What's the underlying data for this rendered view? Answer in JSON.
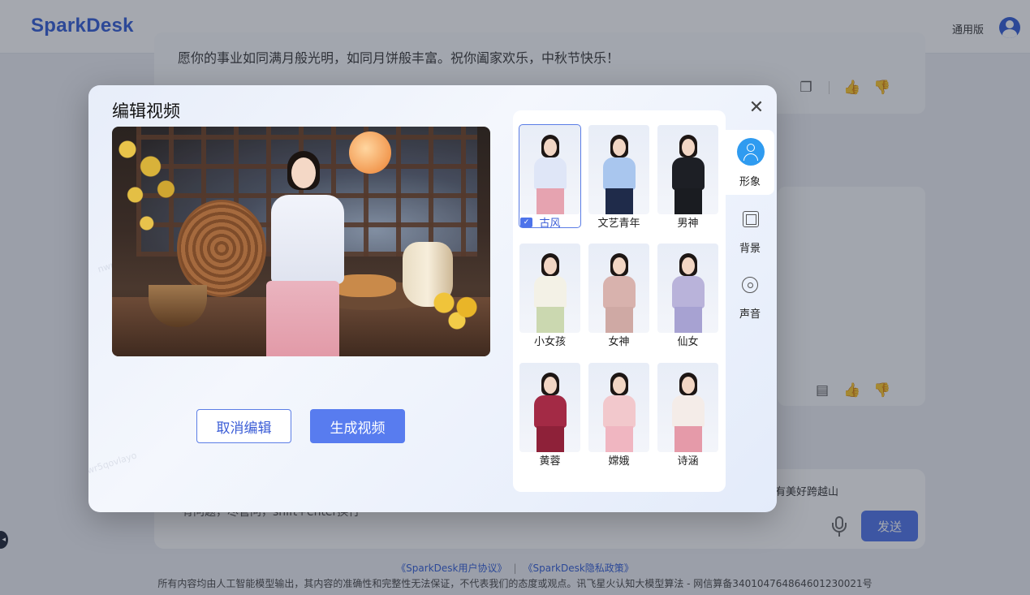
{
  "app": {
    "logo": "SparkDesk",
    "edition_label": "通用版"
  },
  "chat": {
    "message_text": "愿你的事业如同满月般光明，如同月饼般丰富。祝你阖家欢乐，中秋节快乐！",
    "composer_hint": "有问题，尽管问，shift+enter换行",
    "suggestion_text": "有美好跨越山",
    "send_label": "发送"
  },
  "footer": {
    "link_user_agreement": "《SparkDesk用户协议》",
    "link_privacy": "《SparkDesk隐私政策》",
    "separator": "|",
    "note": "所有内容均由人工智能模型输出，其内容的准确性和完整性无法保证，不代表我们的态度或观点。讯飞星火认知大模型算法 - 网信算备340104764864601230021号"
  },
  "modal": {
    "title": "编辑视频",
    "close_symbol": "✕",
    "cancel_label": "取消编辑",
    "generate_label": "生成视频",
    "avatars": [
      {
        "label": "古风",
        "selected": true,
        "top_color": "#dfe6f7",
        "bottom_color": "#e6a3b0"
      },
      {
        "label": "文艺青年",
        "selected": false,
        "top_color": "#a9c6ee",
        "bottom_color": "#1f2b4a"
      },
      {
        "label": "男神",
        "selected": false,
        "top_color": "#1d1f25",
        "bottom_color": "#1a1c21"
      },
      {
        "label": "小女孩",
        "selected": false,
        "top_color": "#f3f1e6",
        "bottom_color": "#cbd8b0"
      },
      {
        "label": "女神",
        "selected": false,
        "top_color": "#d8b2ad",
        "bottom_color": "#cfa9a4"
      },
      {
        "label": "仙女",
        "selected": false,
        "top_color": "#b9b3da",
        "bottom_color": "#a7a2d2"
      },
      {
        "label": "黄蓉",
        "selected": false,
        "top_color": "#a32a45",
        "bottom_color": "#8e2139"
      },
      {
        "label": "嫦娥",
        "selected": false,
        "top_color": "#f2c8cc",
        "bottom_color": "#f0b6c1"
      },
      {
        "label": "诗涵",
        "selected": false,
        "top_color": "#f4ece8",
        "bottom_color": "#e59aa9"
      }
    ],
    "tabs": [
      {
        "label": "形象",
        "icon": "person-icon",
        "active": true
      },
      {
        "label": "背景",
        "icon": "background-icon",
        "active": false
      },
      {
        "label": "声音",
        "icon": "voice-icon",
        "active": false
      }
    ]
  },
  "colors": {
    "accent": "#587cef",
    "tab_active_icon": "#2f9bf0",
    "brand": "#2f5bd6"
  }
}
